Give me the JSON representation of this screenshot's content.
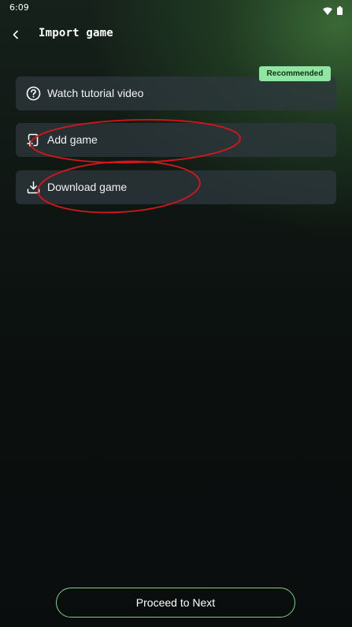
{
  "status_bar": {
    "time": "6:09",
    "icons": [
      "wifi-icon",
      "battery-icon"
    ]
  },
  "header": {
    "back_icon": "chevron-left-icon",
    "title": "Import game"
  },
  "options": [
    {
      "label": "Watch tutorial video",
      "icon": "help-circle-icon",
      "badge": "Recommended"
    },
    {
      "label": "Add game",
      "icon": "add-file-icon"
    },
    {
      "label": "Download game",
      "icon": "download-icon"
    }
  ],
  "footer": {
    "proceed_label": "Proceed to Next"
  },
  "colors": {
    "accent_green": "#8fe6a0",
    "button_border": "#7fcf8c",
    "card_bg": "#2d373c",
    "annotation_red": "#d9151c"
  }
}
